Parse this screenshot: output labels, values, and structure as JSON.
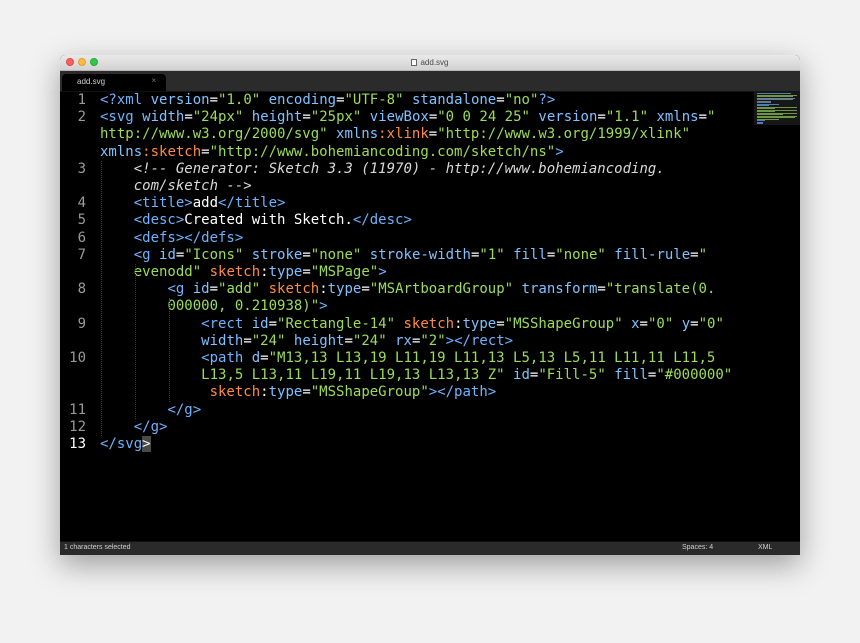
{
  "window": {
    "title": "add.svg"
  },
  "tabs": [
    {
      "label": "add.svg",
      "close": "×"
    }
  ],
  "editor": {
    "line_numbers": [
      "1",
      "2",
      "3",
      "4",
      "5",
      "6",
      "7",
      "8",
      "9",
      "10",
      "11",
      "12",
      "13"
    ],
    "active_line": "13",
    "lines": [
      [
        [
          "tag",
          "<?xml "
        ],
        [
          "attr",
          "version"
        ],
        [
          "text",
          "="
        ],
        [
          "str",
          "\"1.0\""
        ],
        [
          "text",
          " "
        ],
        [
          "attr",
          "encoding"
        ],
        [
          "text",
          "="
        ],
        [
          "str",
          "\"UTF-8\""
        ],
        [
          "text",
          " "
        ],
        [
          "attr",
          "standalone"
        ],
        [
          "text",
          "="
        ],
        [
          "str",
          "\"no\""
        ],
        [
          "tag",
          "?>"
        ]
      ],
      [
        [
          "tag",
          "<svg "
        ],
        [
          "attr",
          "width"
        ],
        [
          "text",
          "="
        ],
        [
          "str",
          "\"24px\""
        ],
        [
          "text",
          " "
        ],
        [
          "attr",
          "height"
        ],
        [
          "text",
          "="
        ],
        [
          "str",
          "\"25px\""
        ],
        [
          "text",
          " "
        ],
        [
          "attr",
          "viewBox"
        ],
        [
          "text",
          "="
        ],
        [
          "str",
          "\"0 0 24 25\""
        ],
        [
          "text",
          " "
        ],
        [
          "attr",
          "version"
        ],
        [
          "text",
          "="
        ],
        [
          "str",
          "\"1.1\""
        ],
        [
          "text",
          " "
        ],
        [
          "attr",
          "xmlns"
        ],
        [
          "text",
          "="
        ],
        [
          "str",
          "\""
        ]
      ],
      [
        [
          "str",
          "http://www.w3.org/2000/svg\""
        ],
        [
          "text",
          " "
        ],
        [
          "attr",
          "xmlns"
        ],
        [
          "ns",
          ":xlink"
        ],
        [
          "text",
          "="
        ],
        [
          "str",
          "\"http://www.w3.org/1999/xlink\""
        ]
      ],
      [
        [
          "attr",
          "xmlns"
        ],
        [
          "ns",
          ":sketch"
        ],
        [
          "text",
          "="
        ],
        [
          "str",
          "\"http://www.bohemiancoding.com/sketch/ns\""
        ],
        [
          "tag",
          ">"
        ]
      ],
      [
        [
          "text",
          "    "
        ],
        [
          "comment",
          "<!-- Generator: Sketch 3.3 (11970) - http://www.bohemiancoding."
        ]
      ],
      [
        [
          "text",
          "    "
        ],
        [
          "comment",
          "com/sketch -->"
        ]
      ],
      [
        [
          "text",
          "    "
        ],
        [
          "tag",
          "<title>"
        ],
        [
          "text",
          "add"
        ],
        [
          "tag",
          "</title>"
        ]
      ],
      [
        [
          "text",
          "    "
        ],
        [
          "tag",
          "<desc>"
        ],
        [
          "text",
          "Created with Sketch."
        ],
        [
          "tag",
          "</desc>"
        ]
      ],
      [
        [
          "text",
          "    "
        ],
        [
          "tag",
          "<defs></defs>"
        ]
      ],
      [
        [
          "text",
          "    "
        ],
        [
          "tag",
          "<g "
        ],
        [
          "attr",
          "id"
        ],
        [
          "text",
          "="
        ],
        [
          "str",
          "\"Icons\""
        ],
        [
          "text",
          " "
        ],
        [
          "attr",
          "stroke"
        ],
        [
          "text",
          "="
        ],
        [
          "str",
          "\"none\""
        ],
        [
          "text",
          " "
        ],
        [
          "attr",
          "stroke-width"
        ],
        [
          "text",
          "="
        ],
        [
          "str",
          "\"1\""
        ],
        [
          "text",
          " "
        ],
        [
          "attr",
          "fill"
        ],
        [
          "text",
          "="
        ],
        [
          "str",
          "\"none\""
        ],
        [
          "text",
          " "
        ],
        [
          "attr",
          "fill-rule"
        ],
        [
          "text",
          "="
        ],
        [
          "str",
          "\""
        ]
      ],
      [
        [
          "text",
          "    "
        ],
        [
          "str",
          "evenodd\""
        ],
        [
          "text",
          " "
        ],
        [
          "ns",
          "sketch"
        ],
        [
          "text",
          ":"
        ],
        [
          "attr",
          "type"
        ],
        [
          "text",
          "="
        ],
        [
          "str",
          "\"MSPage\""
        ],
        [
          "tag",
          ">"
        ]
      ],
      [
        [
          "text",
          "        "
        ],
        [
          "tag",
          "<g "
        ],
        [
          "attr",
          "id"
        ],
        [
          "text",
          "="
        ],
        [
          "str",
          "\"add\""
        ],
        [
          "text",
          " "
        ],
        [
          "ns",
          "sketch"
        ],
        [
          "text",
          ":"
        ],
        [
          "attr",
          "type"
        ],
        [
          "text",
          "="
        ],
        [
          "str",
          "\"MSArtboardGroup\""
        ],
        [
          "text",
          " "
        ],
        [
          "attr",
          "transform"
        ],
        [
          "text",
          "="
        ],
        [
          "str",
          "\"translate(0."
        ]
      ],
      [
        [
          "text",
          "        "
        ],
        [
          "str",
          "000000, 0.210938)\""
        ],
        [
          "tag",
          ">"
        ]
      ],
      [
        [
          "text",
          "            "
        ],
        [
          "tag",
          "<rect "
        ],
        [
          "attr",
          "id"
        ],
        [
          "text",
          "="
        ],
        [
          "str",
          "\"Rectangle-14\""
        ],
        [
          "text",
          " "
        ],
        [
          "ns",
          "sketch"
        ],
        [
          "text",
          ":"
        ],
        [
          "attr",
          "type"
        ],
        [
          "text",
          "="
        ],
        [
          "str",
          "\"MSShapeGroup\""
        ],
        [
          "text",
          " "
        ],
        [
          "attr",
          "x"
        ],
        [
          "text",
          "="
        ],
        [
          "str",
          "\"0\""
        ],
        [
          "text",
          " "
        ],
        [
          "attr",
          "y"
        ],
        [
          "text",
          "="
        ],
        [
          "str",
          "\"0\""
        ]
      ],
      [
        [
          "text",
          "            "
        ],
        [
          "attr",
          "width"
        ],
        [
          "text",
          "="
        ],
        [
          "str",
          "\"24\""
        ],
        [
          "text",
          " "
        ],
        [
          "attr",
          "height"
        ],
        [
          "text",
          "="
        ],
        [
          "str",
          "\"24\""
        ],
        [
          "text",
          " "
        ],
        [
          "attr",
          "rx"
        ],
        [
          "text",
          "="
        ],
        [
          "str",
          "\"2\""
        ],
        [
          "tag",
          "></rect>"
        ]
      ],
      [
        [
          "text",
          "            "
        ],
        [
          "tag",
          "<path "
        ],
        [
          "attr",
          "d"
        ],
        [
          "text",
          "="
        ],
        [
          "str",
          "\"M13,13 L13,19 L11,19 L11,13 L5,13 L5,11 L11,11 L11,5"
        ]
      ],
      [
        [
          "text",
          "            "
        ],
        [
          "str",
          "L13,5 L13,11 L19,11 L19,13 L13,13 Z\""
        ],
        [
          "text",
          " "
        ],
        [
          "attr",
          "id"
        ],
        [
          "text",
          "="
        ],
        [
          "str",
          "\"Fill-5\""
        ],
        [
          "text",
          " "
        ],
        [
          "attr",
          "fill"
        ],
        [
          "text",
          "="
        ],
        [
          "str",
          "\"#000000\""
        ]
      ],
      [
        [
          "text",
          "             "
        ],
        [
          "ns",
          "sketch"
        ],
        [
          "text",
          ":"
        ],
        [
          "attr",
          "type"
        ],
        [
          "text",
          "="
        ],
        [
          "str",
          "\"MSShapeGroup\""
        ],
        [
          "tag",
          "></path>"
        ]
      ],
      [
        [
          "text",
          "        "
        ],
        [
          "tag",
          "</g>"
        ]
      ],
      [
        [
          "text",
          "    "
        ],
        [
          "tag",
          "</g>"
        ]
      ],
      [
        [
          "tag",
          "</svg"
        ],
        [
          "sel",
          ">"
        ]
      ]
    ]
  },
  "status": {
    "selection": "1 characters selected",
    "spaces": "Spaces: 4",
    "syntax": "XML"
  }
}
